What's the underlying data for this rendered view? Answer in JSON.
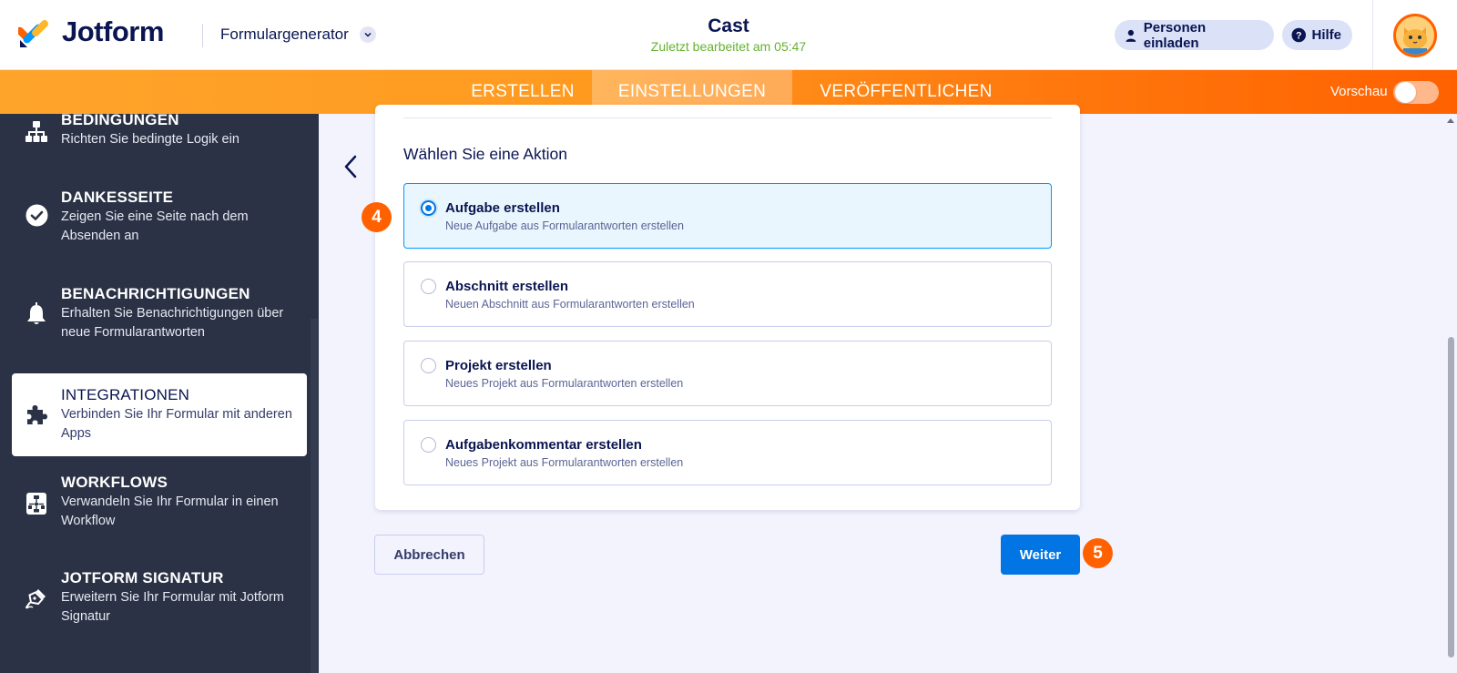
{
  "header": {
    "brand": "Jotform",
    "product_menu": "Formulargenerator",
    "form_title": "Cast",
    "last_edited": "Zuletzt bearbeitet am 05:47",
    "invite_label": "Personen einladen",
    "help_label": "Hilfe"
  },
  "nav": {
    "tabs": [
      {
        "label": "ERSTELLEN"
      },
      {
        "label": "EINSTELLUNGEN",
        "active": true
      },
      {
        "label": "VERÖFFENTLICHEN"
      }
    ],
    "preview_label": "Vorschau",
    "preview_on": false
  },
  "sidebar": {
    "items": [
      {
        "title": "BEDINGUNGEN",
        "desc": "Richten Sie bedingte Logik ein",
        "icon": "conditions-icon"
      },
      {
        "title": "DANKESSEITE",
        "desc": "Zeigen Sie eine Seite nach dem Absenden an",
        "icon": "check-circle-icon"
      },
      {
        "title": "BENACHRICHTIGUNGEN",
        "desc": "Erhalten Sie Benachrichtigungen über neue Formularantworten",
        "icon": "bell-icon"
      },
      {
        "title": "INTEGRATIONEN",
        "desc": "Verbinden Sie Ihr Formular mit anderen Apps",
        "icon": "puzzle-icon",
        "active": true
      },
      {
        "title": "WORKFLOWS",
        "desc": "Verwandeln Sie Ihr Formular in einen Workflow",
        "icon": "workflow-icon"
      },
      {
        "title": "JOTFORM SIGNATUR",
        "desc": "Erweitern Sie Ihr Formular mit Jotform Signatur",
        "icon": "pen-icon"
      }
    ]
  },
  "main": {
    "heading": "Wählen Sie eine Aktion",
    "options": [
      {
        "title": "Aufgabe erstellen",
        "desc": "Neue Aufgabe aus Formularantworten erstellen",
        "selected": true
      },
      {
        "title": "Abschnitt erstellen",
        "desc": "Neuen Abschnitt aus Formularantworten erstellen",
        "selected": false
      },
      {
        "title": "Projekt erstellen",
        "desc": "Neues Projekt aus Formularantworten erstellen",
        "selected": false
      },
      {
        "title": "Aufgabenkommentar erstellen",
        "desc": "Neues Projekt aus Formularantworten erstellen",
        "selected": false
      }
    ],
    "step_badge_options": "4",
    "step_badge_next": "5",
    "cancel_label": "Abbrechen",
    "next_label": "Weiter"
  },
  "colors": {
    "brand_orange": "#ff6100",
    "primary_blue": "#0075e3",
    "sidebar_bg": "#2b3245",
    "edited_green": "#64b22f"
  }
}
